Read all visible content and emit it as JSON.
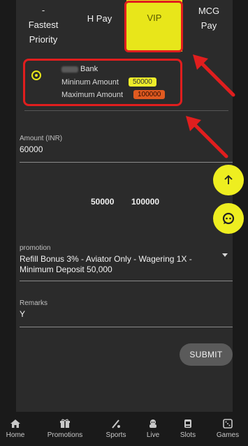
{
  "tabs": [
    {
      "label": "-\nFastest\nPriority"
    },
    {
      "label": "H Pay"
    },
    {
      "label": "VIP"
    },
    {
      "label": "MCG\nPay"
    }
  ],
  "bank": {
    "name": "Bank",
    "min_label": "Mininum Amount",
    "min_value": "50000",
    "max_label": "Maximum Amount",
    "max_value": "100000"
  },
  "amount": {
    "label": "Amount (INR)",
    "value": "60000"
  },
  "presets": [
    "50000",
    "100000"
  ],
  "promotion": {
    "label": "promotion",
    "value": "Refill Bonus 3% - Aviator Only - Wagering 1X - Minimum Deposit 50,000"
  },
  "remarks": {
    "label": "Remarks",
    "value": "Y"
  },
  "submit_label": "SUBMIT",
  "nav": [
    {
      "label": "Home",
      "icon": "home-icon"
    },
    {
      "label": "Promotions",
      "icon": "gift-icon"
    },
    {
      "label": "Sports",
      "icon": "sports-icon"
    },
    {
      "label": "Live",
      "icon": "live-icon"
    },
    {
      "label": "Slots",
      "icon": "slots-icon"
    },
    {
      "label": "Games",
      "icon": "dice-icon"
    }
  ],
  "colors": {
    "accent": "#e8e61a",
    "annotation": "#e01e1e",
    "max_chip": "#e05a20"
  }
}
